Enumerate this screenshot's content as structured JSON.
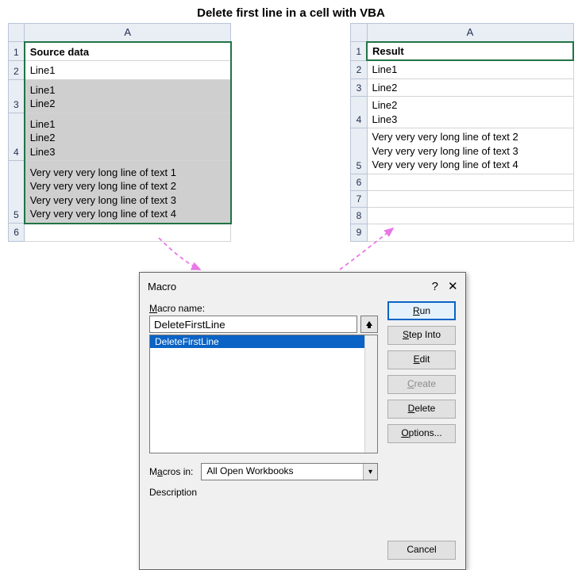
{
  "title": "Delete first line in a cell with VBA",
  "source": {
    "col": "A",
    "header": "Source data",
    "rows": [
      "Line1",
      "Line1\nLine2",
      "Line1\nLine2\nLine3",
      "Very very very long line of text 1\nVery very very long line of text 2\nVery very very long line of text 3\nVery very very long line of text 4"
    ],
    "empty_rows": [
      "6"
    ]
  },
  "result": {
    "col": "A",
    "header": "Result",
    "rows": [
      "Line1",
      "Line2",
      "Line2\nLine3",
      "Very very very long line of text 2\nVery very very long line of text 3\nVery very very long line of text 4"
    ],
    "empty_rows": [
      "6",
      "7",
      "8",
      "9"
    ]
  },
  "dialog": {
    "title": "Macro",
    "name_label": "Macro name:",
    "name_value": "DeleteFirstLine",
    "list_item": "DeleteFirstLine",
    "buttons": {
      "run": "Run",
      "step_into": "Step Into",
      "edit": "Edit",
      "create": "Create",
      "delete": "Delete",
      "options": "Options..."
    },
    "macros_in_label": "Macros in:",
    "macros_in_value": "All Open Workbooks",
    "description_label": "Description",
    "cancel": "Cancel"
  }
}
